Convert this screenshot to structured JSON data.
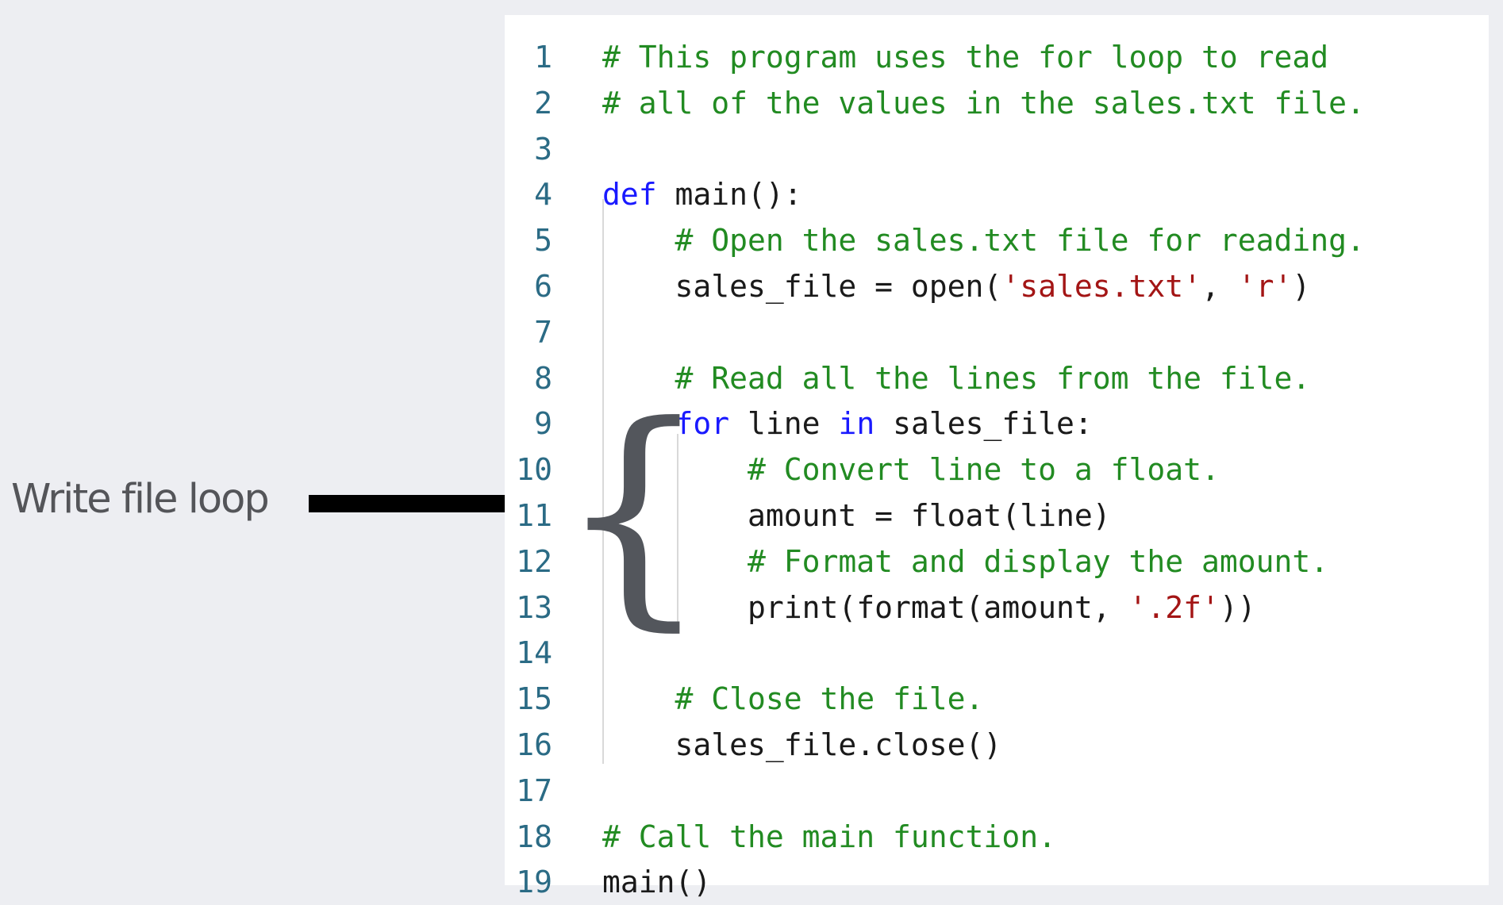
{
  "annotation": {
    "label": "Write file loop",
    "brace": "{"
  },
  "colors": {
    "background": "#edeef2",
    "panel": "#ffffff",
    "line_number": "#2b6b85",
    "comment": "#228b22",
    "keyword": "#1a1aff",
    "string": "#a31515",
    "text": "#1a1a1a",
    "annotation": "#545559"
  },
  "code": {
    "lines": [
      {
        "number": "1",
        "tokens": [
          [
            "comment",
            "# This program uses the for loop to read"
          ]
        ]
      },
      {
        "number": "2",
        "tokens": [
          [
            "comment",
            "# all of the values in the sales.txt file."
          ]
        ]
      },
      {
        "number": "3",
        "tokens": []
      },
      {
        "number": "4",
        "tokens": [
          [
            "keyword",
            "def"
          ],
          [
            "plain",
            " main():"
          ]
        ]
      },
      {
        "number": "5",
        "tokens": [
          [
            "plain",
            "    "
          ],
          [
            "comment",
            "# Open the sales.txt file for reading."
          ]
        ]
      },
      {
        "number": "6",
        "tokens": [
          [
            "plain",
            "    sales_file = open("
          ],
          [
            "string",
            "'sales.txt'"
          ],
          [
            "plain",
            ", "
          ],
          [
            "string",
            "'r'"
          ],
          [
            "plain",
            ")"
          ]
        ]
      },
      {
        "number": "7",
        "tokens": []
      },
      {
        "number": "8",
        "tokens": [
          [
            "plain",
            "    "
          ],
          [
            "comment",
            "# Read all the lines from the file."
          ]
        ]
      },
      {
        "number": "9",
        "tokens": [
          [
            "plain",
            "    "
          ],
          [
            "keyword",
            "for"
          ],
          [
            "plain",
            " line "
          ],
          [
            "keyword",
            "in"
          ],
          [
            "plain",
            " sales_file:"
          ]
        ]
      },
      {
        "number": "10",
        "tokens": [
          [
            "plain",
            "        "
          ],
          [
            "comment",
            "# Convert line to a float."
          ]
        ]
      },
      {
        "number": "11",
        "tokens": [
          [
            "plain",
            "        amount = float(line)"
          ]
        ]
      },
      {
        "number": "12",
        "tokens": [
          [
            "plain",
            "        "
          ],
          [
            "comment",
            "# Format and display the amount."
          ]
        ]
      },
      {
        "number": "13",
        "tokens": [
          [
            "plain",
            "        print(format(amount, "
          ],
          [
            "string",
            "'.2f'"
          ],
          [
            "plain",
            "))"
          ]
        ]
      },
      {
        "number": "14",
        "tokens": []
      },
      {
        "number": "15",
        "tokens": [
          [
            "plain",
            "    "
          ],
          [
            "comment",
            "# Close the file."
          ]
        ]
      },
      {
        "number": "16",
        "tokens": [
          [
            "plain",
            "    sales_file.close()"
          ]
        ]
      },
      {
        "number": "17",
        "tokens": []
      },
      {
        "number": "18",
        "tokens": [
          [
            "comment",
            "# Call the main function."
          ]
        ]
      },
      {
        "number": "19",
        "tokens": [
          [
            "plain",
            "main()"
          ]
        ]
      }
    ]
  }
}
